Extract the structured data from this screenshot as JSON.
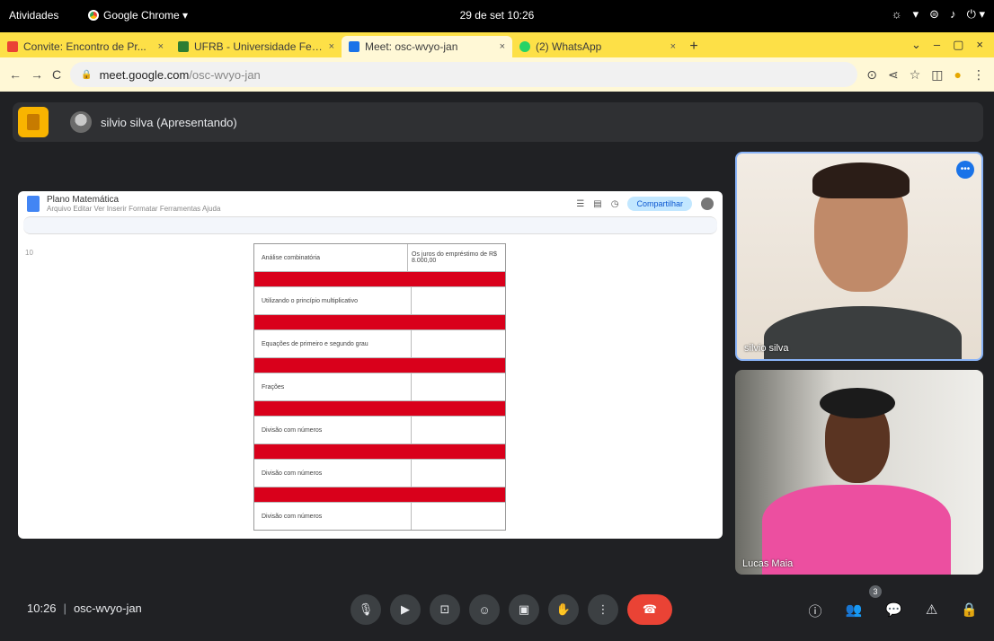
{
  "os": {
    "activities": "Atividades",
    "app_name": "Google Chrome ▾",
    "clock": "29 de set 10:26",
    "tray": [
      "☼",
      "▾",
      "⊜",
      "♪",
      "⏻ ▾"
    ]
  },
  "tabs": [
    {
      "title": "Convite: Encontro de Pr...",
      "color": "#ea4335",
      "close": "×"
    },
    {
      "title": "UFRB - Universidade Fed...",
      "color": "#2e7d32",
      "close": "×"
    },
    {
      "title": "Meet: osc-wvyo-jan",
      "color": "#1a73e8",
      "close": "×",
      "active": true
    },
    {
      "title": "(2) WhatsApp",
      "color": "#25d366",
      "close": "×"
    }
  ],
  "tabs_new": "+",
  "window_controls": [
    "⌄",
    "–",
    "▢",
    "×"
  ],
  "nav": {
    "back": "←",
    "forward": "→",
    "reload": "C"
  },
  "address": {
    "lock": "🔒",
    "domain": "meet.google.com",
    "path": "/osc-wvyo-jan"
  },
  "addr_right": [
    "⊙",
    "⋖",
    "☆",
    "◫",
    "●",
    "⋮"
  ],
  "presenter": {
    "label": "silvio silva (Apresentando)"
  },
  "doc": {
    "title": "Plano Matemática",
    "menus": "Arquivo  Editar  Ver  Inserir  Formatar  Ferramentas  Ajuda",
    "share": "Compartilhar",
    "ruler": "10",
    "rows": [
      {
        "c1": "Análise combinatória",
        "c2": "Os juros do empréstimo de R$ 8.000,00"
      },
      {
        "c1": "Utilizando o princípio multiplicativo",
        "c2": ""
      },
      {
        "c1": "Equações de primeiro e segundo grau",
        "c2": ""
      },
      {
        "c1": "Frações",
        "c2": ""
      },
      {
        "c1": "Divisão com números",
        "c2": ""
      },
      {
        "c1": "Divisão com números",
        "c2": ""
      },
      {
        "c1": "Divisão com números",
        "c2": ""
      }
    ]
  },
  "participants": [
    {
      "name": "silvio silva",
      "more": "•••"
    },
    {
      "name": "Lucas Maia"
    }
  ],
  "meeting": {
    "time": "10:26",
    "sep": "|",
    "code": "osc-wvyo-jan"
  },
  "controls": [
    "🎙",
    "▶",
    "⊡",
    "☺",
    "▣",
    "✋",
    "⋮",
    "☎"
  ],
  "right_controls": [
    "ⓘ",
    "👥",
    "💬",
    "⚠",
    "🔒"
  ],
  "participant_count": "3"
}
